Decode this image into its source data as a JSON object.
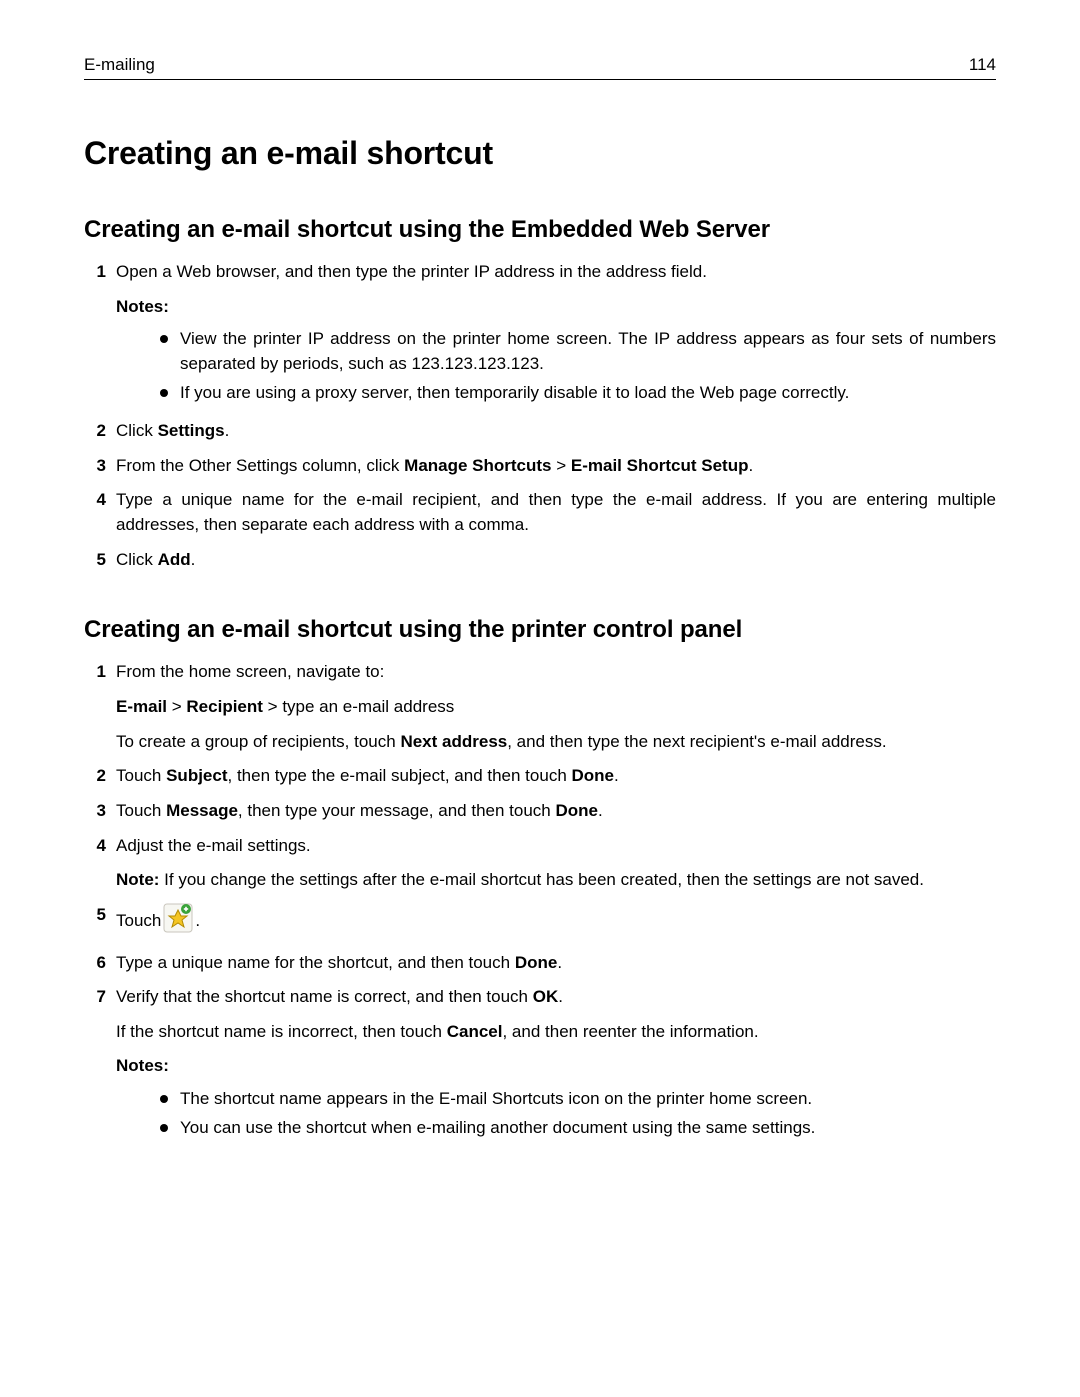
{
  "header": {
    "section": "E-mailing",
    "page": "114"
  },
  "title": "Creating an e-mail shortcut",
  "sectionA": {
    "heading": "Creating an e-mail shortcut using the Embedded Web Server",
    "steps": {
      "s1": {
        "text": "Open a Web browser, and then type the printer IP address in the address field.",
        "notes_label": "Notes:",
        "n1": "View the printer IP address on the printer home screen. The IP address appears as four sets of numbers separated by periods, such as 123.123.123.123.",
        "n2": "If you are using a proxy server, then temporarily disable it to load the Web page correctly."
      },
      "s2": {
        "pre": "Click ",
        "b": "Settings",
        "post": "."
      },
      "s3": {
        "pre": "From the Other Settings column, click ",
        "b1": "Manage Shortcuts",
        "gt": " > ",
        "b2": "E-mail Shortcut Setup",
        "post": "."
      },
      "s4": "Type a unique name for the e-mail recipient, and then type the e-mail address. If you are entering multiple addresses, then separate each address with a comma.",
      "s5": {
        "pre": "Click ",
        "b": "Add",
        "post": "."
      }
    }
  },
  "sectionB": {
    "heading": "Creating an e-mail shortcut using the printer control panel",
    "steps": {
      "s1": {
        "text": "From the home screen, navigate to:",
        "line2": {
          "b1": "E-mail",
          "gt1": " > ",
          "b2": "Recipient",
          "gt2": " > ",
          "tail": "type an e-mail address"
        },
        "line3": {
          "pre": "To create a group of recipients, touch ",
          "b": "Next address",
          "post": ", and then type the next recipient's e-mail address."
        }
      },
      "s2": {
        "pre": "Touch ",
        "b1": "Subject",
        "mid": ", then type the e-mail subject, and then touch ",
        "b2": "Done",
        "post": "."
      },
      "s3": {
        "pre": "Touch ",
        "b1": "Message",
        "mid": ", then type your message, and then touch ",
        "b2": "Done",
        "post": "."
      },
      "s4": {
        "text": "Adjust the e-mail settings.",
        "note": {
          "b": "Note:",
          "post": " If you change the settings after the e-mail shortcut has been created, then the settings are not saved."
        }
      },
      "s5": {
        "pre": "Touch ",
        "post": " ."
      },
      "s6": {
        "pre": "Type a unique name for the shortcut, and then touch ",
        "b": "Done",
        "post": "."
      },
      "s7": {
        "line1": {
          "pre": "Verify that the shortcut name is correct, and then touch ",
          "b": "OK",
          "post": "."
        },
        "line2": {
          "pre": "If the shortcut name is incorrect, then touch ",
          "b": "Cancel",
          "post": ", and then reenter the information."
        },
        "notes_label": "Notes:",
        "n1": "The shortcut name appears in the E-mail Shortcuts icon on the printer home screen.",
        "n2": "You can use the shortcut when e-mailing another document using the same settings."
      }
    }
  }
}
